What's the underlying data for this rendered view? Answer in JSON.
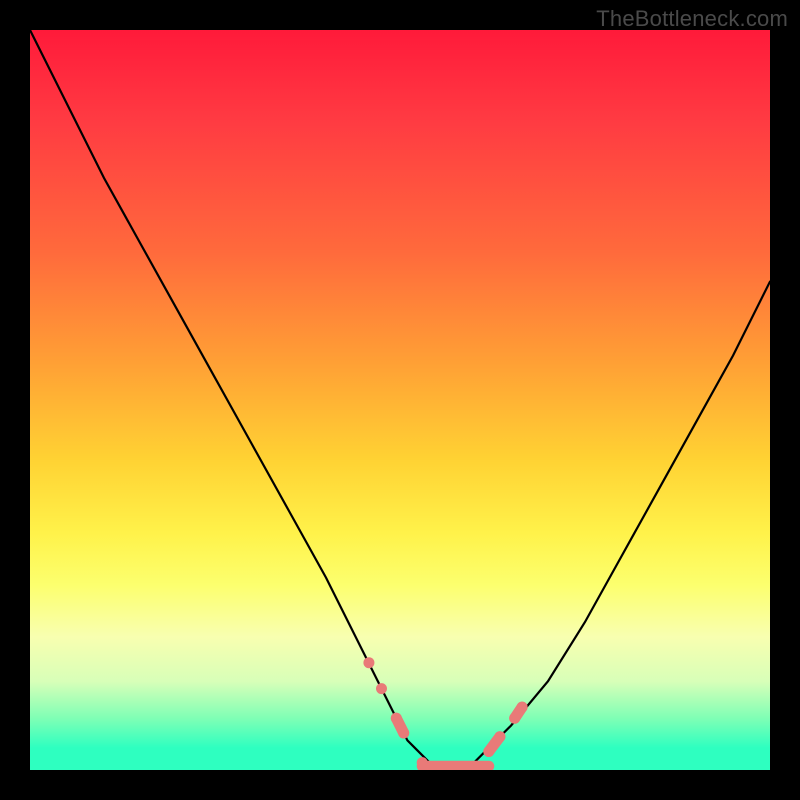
{
  "watermark": "TheBottleneck.com",
  "chart_data": {
    "type": "line",
    "title": "",
    "xlabel": "",
    "ylabel": "",
    "xlim": [
      0,
      100
    ],
    "ylim": [
      0,
      100
    ],
    "grid": false,
    "legend": false,
    "annotations": [],
    "series": [
      {
        "name": "bottleneck-curve",
        "color": "#000000",
        "x": [
          0,
          5,
          10,
          15,
          20,
          25,
          30,
          35,
          40,
          43,
          46,
          49,
          50,
          51,
          52,
          54,
          56,
          58,
          60,
          62,
          65,
          70,
          75,
          80,
          85,
          90,
          95,
          100
        ],
        "values": [
          100,
          90,
          80,
          71,
          62,
          53,
          44,
          35,
          26,
          20,
          14,
          8,
          6,
          4,
          3,
          1,
          0,
          0,
          1,
          3,
          6,
          12,
          20,
          29,
          38,
          47,
          56,
          66
        ]
      }
    ],
    "flat_region": {
      "x_start": 53,
      "x_end": 62,
      "y": 0.5,
      "marker_color": "#e97a78"
    },
    "markers": [
      {
        "x": 45.8,
        "y": 14.5
      },
      {
        "x": 47.5,
        "y": 11.0
      },
      {
        "x": 49.5,
        "y": 7.0
      },
      {
        "x": 50.5,
        "y": 5.0
      },
      {
        "x": 53.0,
        "y": 1.0
      },
      {
        "x": 62.0,
        "y": 2.5
      },
      {
        "x": 63.5,
        "y": 4.5
      },
      {
        "x": 65.5,
        "y": 7.0
      },
      {
        "x": 66.5,
        "y": 8.5
      }
    ],
    "background_gradient": {
      "top": "#ff1a3a",
      "bottom": "#2effc0"
    }
  }
}
